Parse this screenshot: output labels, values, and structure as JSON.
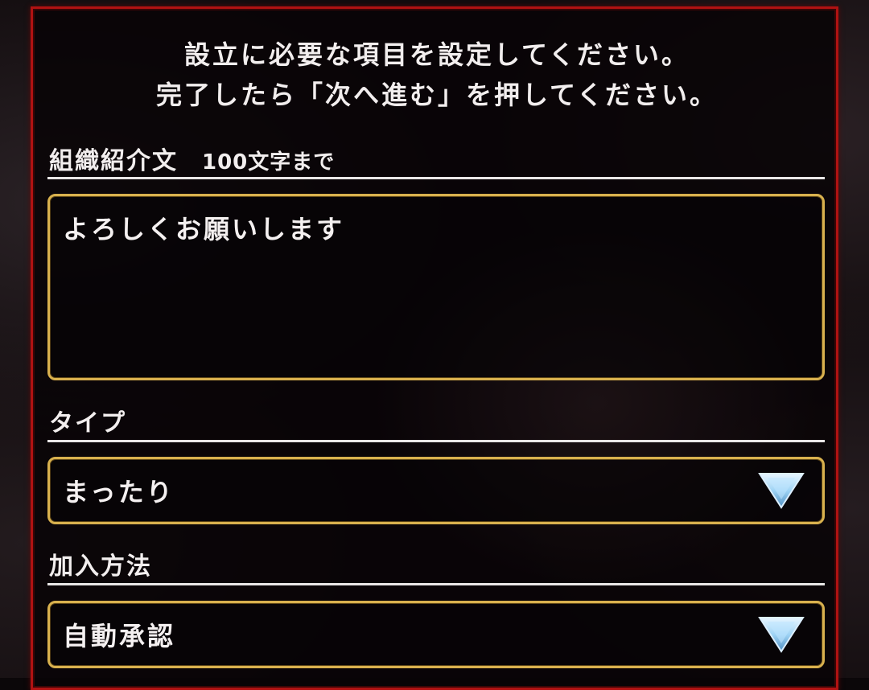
{
  "instructions": {
    "line1": "設立に必要な項目を設定してください。",
    "line2": "完了したら「次へ進む」を押してください。"
  },
  "intro": {
    "label": "組織紹介文",
    "hint": "100文字まで",
    "value": "よろしくお願いします"
  },
  "type": {
    "label": "タイプ",
    "selected": "まったり"
  },
  "join_method": {
    "label": "加入方法",
    "selected": "自動承認"
  },
  "colors": {
    "frame": "#b01212",
    "field_border": "#d9b14e",
    "arrow": "#9fd4f5"
  },
  "icons": [
    "chevron-down-icon"
  ]
}
